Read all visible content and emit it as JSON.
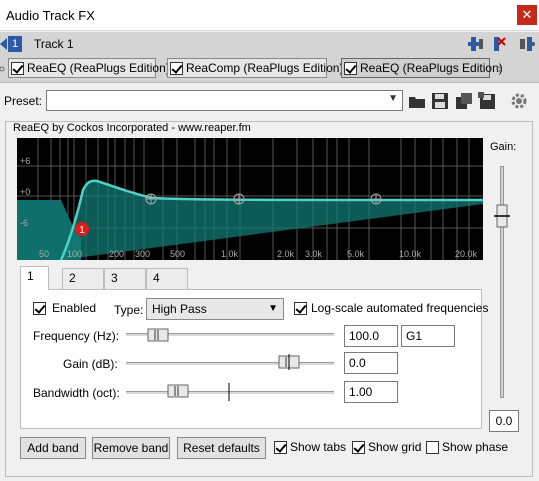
{
  "window": {
    "title": "Audio Track FX",
    "close_label": "✕"
  },
  "track": {
    "number": "1",
    "name": "Track 1"
  },
  "fx_chain": [
    {
      "label": "ReaEQ (ReaPlugs Edition)",
      "enabled": true,
      "selected": false
    },
    {
      "label": "ReaComp (ReaPlugs Edition)",
      "enabled": true,
      "selected": false
    },
    {
      "label": "ReaEQ (ReaPlugs Edition)",
      "enabled": true,
      "selected": true
    }
  ],
  "preset": {
    "label": "Preset:",
    "value": ""
  },
  "plugin": {
    "title": "ReaEQ by Cockos Incorporated - www.reaper.fm"
  },
  "graph": {
    "db_labels": [
      "+6",
      "+0",
      "-6"
    ],
    "freq_labels": [
      "50",
      "100",
      "200",
      "300",
      "500",
      "1.0k",
      "2.0k",
      "3.0k",
      "5.0k",
      "10.0k",
      "20.0k"
    ],
    "band_marker": "1",
    "curve_color": "#4fd1c5"
  },
  "gain_panel": {
    "label": "Gain:",
    "value": "0.0"
  },
  "band_tabs": [
    "1",
    "2",
    "3",
    "4"
  ],
  "band": {
    "enabled_label": "Enabled",
    "enabled": true,
    "type_label": "Type:",
    "type_value": "High Pass",
    "log_scale_label": "Log-scale automated frequencies",
    "log_scale": true,
    "frequency_label": "Frequency (Hz):",
    "frequency_value": "100.0",
    "note_value": "G1",
    "gain_label": "Gain (dB):",
    "gain_value": "0.0",
    "bandwidth_label": "Bandwidth (oct):",
    "bandwidth_value": "1.00"
  },
  "buttons": {
    "add_band": "Add band",
    "remove_band": "Remove band",
    "reset_defaults": "Reset defaults"
  },
  "options": {
    "show_tabs_label": "Show tabs",
    "show_tabs": true,
    "show_grid_label": "Show grid",
    "show_grid": true,
    "show_phase_label": "Show phase",
    "show_phase": false
  }
}
